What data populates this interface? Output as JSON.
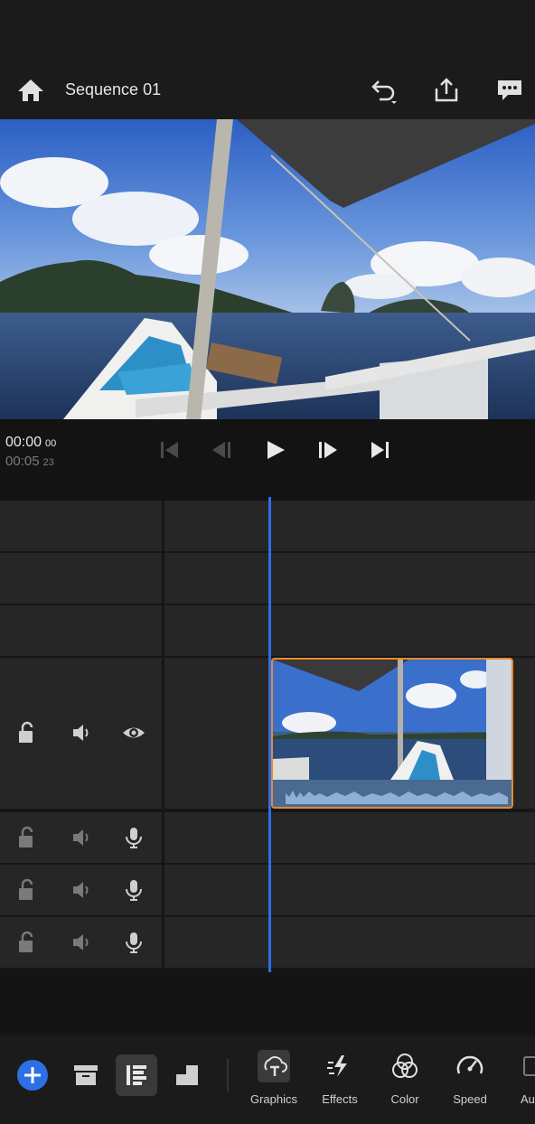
{
  "header": {
    "title": "Sequence 01"
  },
  "transport": {
    "current_time": "00:00",
    "current_frames": "00",
    "duration_time": "00:05",
    "duration_frames": "23"
  },
  "toolbar": {
    "tools": [
      {
        "label": "Graphics",
        "icon": "graphics-icon"
      },
      {
        "label": "Effects",
        "icon": "effects-icon"
      },
      {
        "label": "Color",
        "icon": "color-icon"
      },
      {
        "label": "Speed",
        "icon": "speed-icon"
      },
      {
        "label": "Au",
        "icon": "audio-icon"
      }
    ]
  },
  "colors": {
    "accent": "#2d6fe5",
    "clip_border": "#e8892f",
    "background": "#161616",
    "track": "#262626"
  }
}
